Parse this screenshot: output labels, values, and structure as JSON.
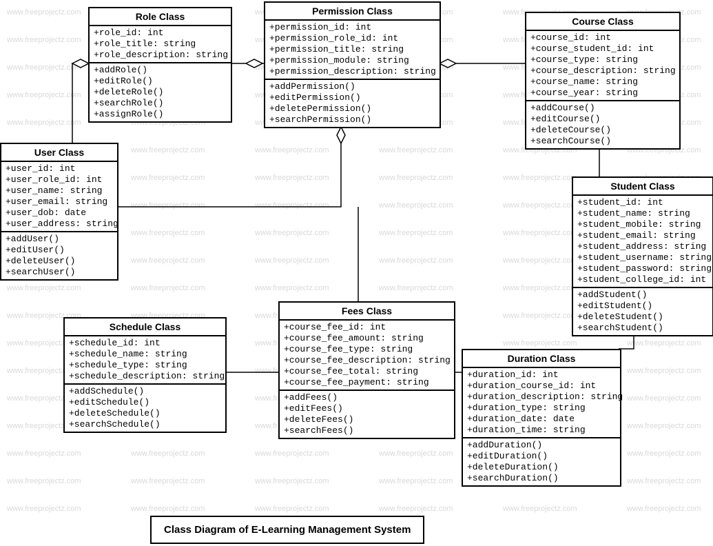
{
  "watermark_text": "www.freeprojectz.com",
  "caption": "Class Diagram of E-Learning Management System",
  "classes": {
    "role": {
      "title": "Role Class",
      "attributes": [
        "+role_id: int",
        "+role_title: string",
        "+role_description: string"
      ],
      "methods": [
        "+addRole()",
        "+editRole()",
        "+deleteRole()",
        "+searchRole()",
        "+assignRole()"
      ]
    },
    "permission": {
      "title": "Permission Class",
      "attributes": [
        "+permission_id: int",
        "+permission_role_id: int",
        "+permission_title: string",
        "+permission_module: string",
        "+permission_description: string"
      ],
      "methods": [
        "+addPermission()",
        "+editPermission()",
        "+deletePermission()",
        "+searchPermission()"
      ]
    },
    "course": {
      "title": "Course Class",
      "attributes": [
        "+course_id: int",
        "+course_student_id: int",
        "+course_type: string",
        "+course_description: string",
        "+course_name: string",
        "+course_year: string"
      ],
      "methods": [
        "+addCourse()",
        "+editCourse()",
        "+deleteCourse()",
        "+searchCourse()"
      ]
    },
    "user": {
      "title": "User Class",
      "attributes": [
        "+user_id: int",
        "+user_role_id: int",
        "+user_name: string",
        "+user_email: string",
        "+user_dob: date",
        "+user_address: string"
      ],
      "methods": [
        "+addUser()",
        "+editUser()",
        "+deleteUser()",
        "+searchUser()"
      ]
    },
    "student": {
      "title": "Student Class",
      "attributes": [
        "+student_id: int",
        "+student_name: string",
        "+student_mobile: string",
        "+student_email: string",
        "+student_address: string",
        "+student_username: string",
        "+student_password: string",
        "+student_college_id: int"
      ],
      "methods": [
        "+addStudent()",
        "+editStudent()",
        "+deleteStudent()",
        "+searchStudent()"
      ]
    },
    "schedule": {
      "title": "Schedule Class",
      "attributes": [
        "+schedule_id: int",
        "+schedule_name: string",
        "+schedule_type: string",
        "+schedule_description: string"
      ],
      "methods": [
        "+addSchedule()",
        "+editSchedule()",
        "+deleteSchedule()",
        "+searchSchedule()"
      ]
    },
    "fees": {
      "title": "Fees Class",
      "attributes": [
        "+course_fee_id: int",
        "+course_fee_amount: string",
        "+course_fee_type: string",
        "+course_fee_description: string",
        "+course_fee_total: string",
        "+course_fee_payment: string"
      ],
      "methods": [
        "+addFees()",
        "+editFees()",
        "+deleteFees()",
        "+searchFees()"
      ]
    },
    "duration": {
      "title": "Duration Class",
      "attributes": [
        "+duration_id: int",
        "+duration_course_id: int",
        "+duration_description: string",
        "+duration_type: string",
        "+duration_date: date",
        "+duration_time: string"
      ],
      "methods": [
        "+addDuration()",
        "+editDuration()",
        "+deleteDuration()",
        "+searchDuration()"
      ]
    }
  }
}
